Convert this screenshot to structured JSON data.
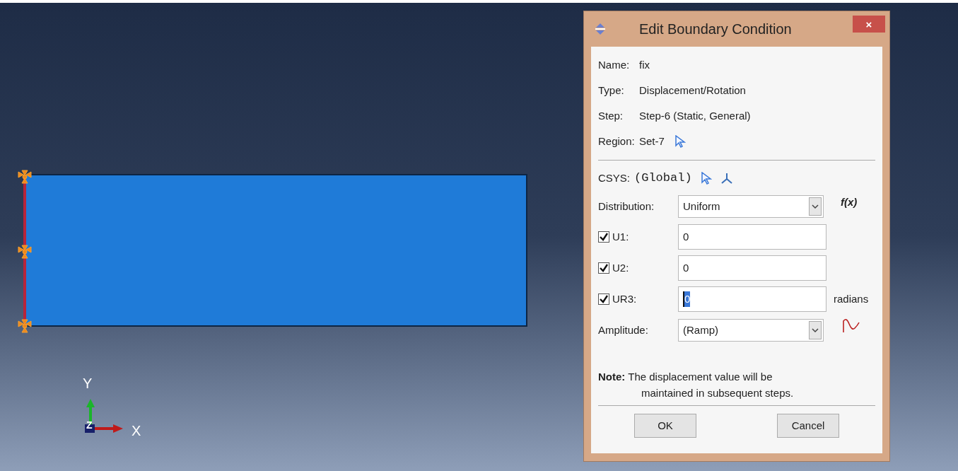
{
  "viewport": {
    "axis_labels": [
      "Y",
      "Z",
      "X"
    ]
  },
  "dialog": {
    "title": "Edit Boundary Condition",
    "close": "×",
    "info": [
      {
        "label": "Name:",
        "value": "fix",
        "pick": false
      },
      {
        "label": "Type:",
        "value": "Displacement/Rotation",
        "pick": false
      },
      {
        "label": "Step:",
        "value": "Step-6 (Static, General)",
        "pick": false
      },
      {
        "label": "Region:",
        "value": "Set-7",
        "pick": true
      }
    ],
    "csys": {
      "label": "CSYS:",
      "value": "(Global)"
    },
    "distribution": {
      "label": "Distribution:",
      "value": "Uniform",
      "function": "f(x)"
    },
    "dofs": [
      {
        "label": "U1:",
        "checked": true,
        "value": "0",
        "focused": false
      },
      {
        "label": "U2:",
        "checked": true,
        "value": "0",
        "focused": false
      },
      {
        "label": "UR3:",
        "checked": true,
        "value": "0",
        "focused": true,
        "unit": "radians"
      }
    ],
    "amplitude": {
      "label": "Amplitude:",
      "value": "(Ramp)"
    },
    "note": "**Note:** The displacement value will be maintained in subsequent steps.",
    "buttons": [
      "OK",
      "Cancel"
    ]
  }
}
